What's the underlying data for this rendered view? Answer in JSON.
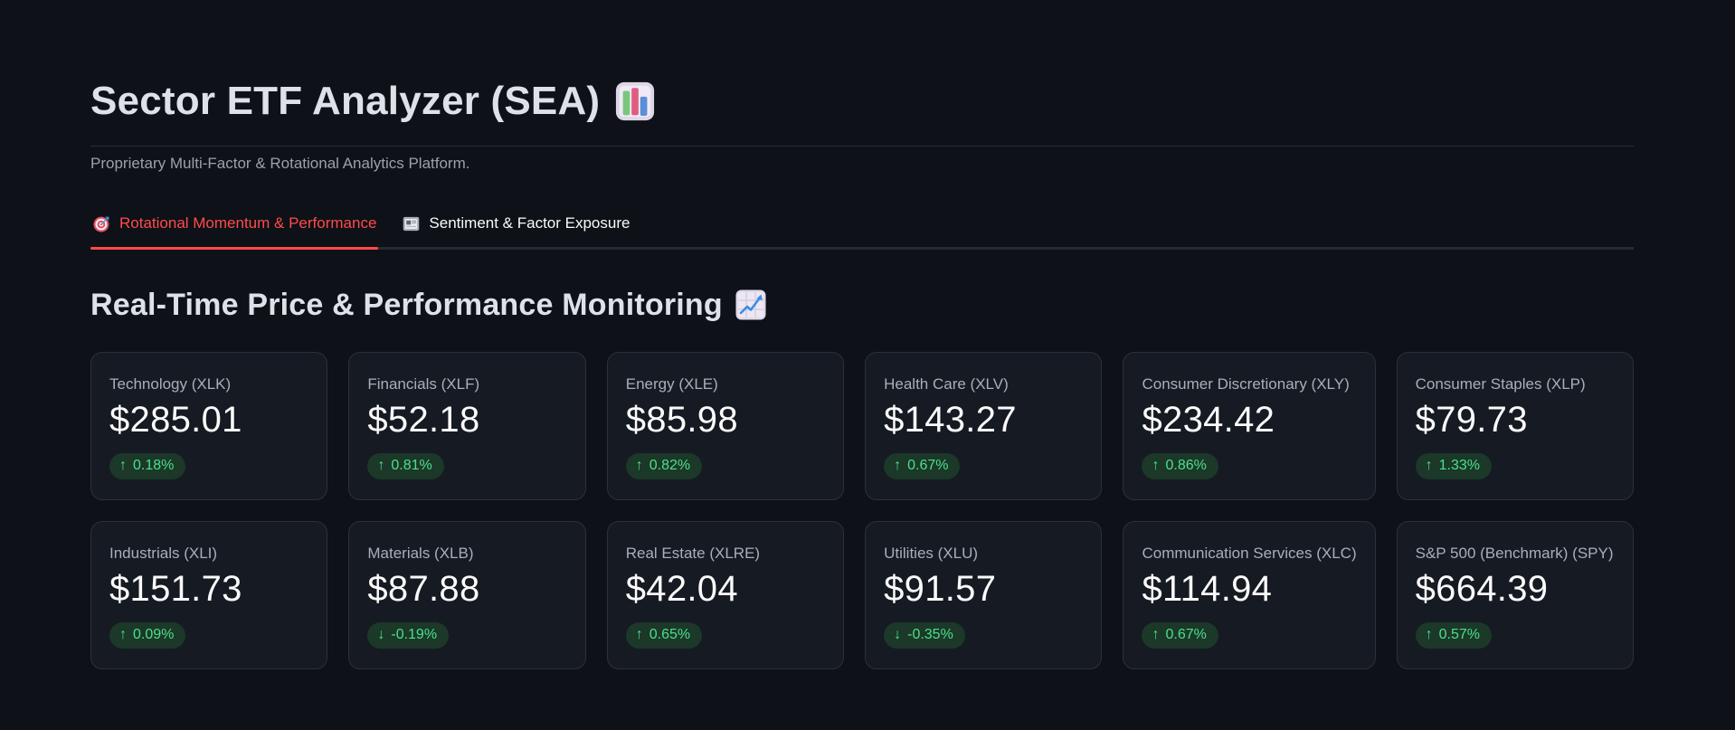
{
  "app": {
    "title": "Sector ETF Analyzer (SEA)",
    "title_icon": "bar-chart-emoji",
    "subtitle": "Proprietary Multi-Factor & Rotational Analytics Platform."
  },
  "tabs": [
    {
      "label": "Rotational Momentum & Performance",
      "icon": "dart-target-emoji",
      "active": true
    },
    {
      "label": "Sentiment & Factor Exposure",
      "icon": "newspaper-emoji",
      "active": false
    }
  ],
  "section": {
    "heading": "Real-Time Price & Performance Monitoring",
    "heading_icon": "chart-increasing-emoji"
  },
  "metrics": [
    {
      "label": "Technology (XLK)",
      "value": "$285.01",
      "arrow": "↑",
      "delta": "0.18%",
      "direction": "up"
    },
    {
      "label": "Financials (XLF)",
      "value": "$52.18",
      "arrow": "↑",
      "delta": "0.81%",
      "direction": "up"
    },
    {
      "label": "Energy (XLE)",
      "value": "$85.98",
      "arrow": "↑",
      "delta": "0.82%",
      "direction": "up"
    },
    {
      "label": "Health Care (XLV)",
      "value": "$143.27",
      "arrow": "↑",
      "delta": "0.67%",
      "direction": "up"
    },
    {
      "label": "Consumer Discretionary (XLY)",
      "value": "$234.42",
      "arrow": "↑",
      "delta": "0.86%",
      "direction": "up"
    },
    {
      "label": "Consumer Staples (XLP)",
      "value": "$79.73",
      "arrow": "↑",
      "delta": "1.33%",
      "direction": "up"
    },
    {
      "label": "Industrials (XLI)",
      "value": "$151.73",
      "arrow": "↑",
      "delta": "0.09%",
      "direction": "up"
    },
    {
      "label": "Materials (XLB)",
      "value": "$87.88",
      "arrow": "↓",
      "delta": "-0.19%",
      "direction": "down"
    },
    {
      "label": "Real Estate (XLRE)",
      "value": "$42.04",
      "arrow": "↑",
      "delta": "0.65%",
      "direction": "up"
    },
    {
      "label": "Utilities (XLU)",
      "value": "$91.57",
      "arrow": "↓",
      "delta": "-0.35%",
      "direction": "down"
    },
    {
      "label": "Communication Services (XLC)",
      "value": "$114.94",
      "arrow": "↑",
      "delta": "0.67%",
      "direction": "up"
    },
    {
      "label": "S&P 500 (Benchmark) (SPY)",
      "value": "$664.39",
      "arrow": "↑",
      "delta": "0.57%",
      "direction": "up"
    }
  ],
  "colors": {
    "page_bg": "#0e1117",
    "card_bg": "#161a22",
    "card_border": "#2b303b",
    "accent_red": "#ff4b4b",
    "delta_text_green": "#4be088",
    "delta_pill_bg": "#1b3829",
    "heading_text": "#dde1e8",
    "value_text": "#fafafa",
    "muted_text": "#9ba1ac"
  }
}
